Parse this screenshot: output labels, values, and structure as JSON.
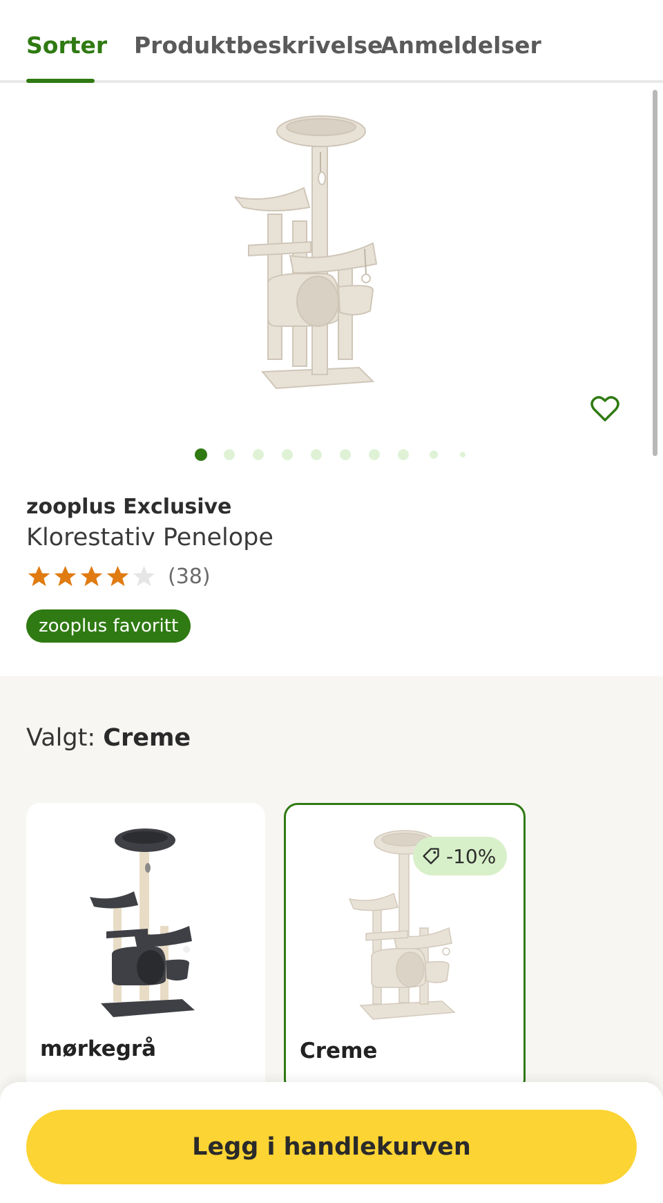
{
  "tabs": [
    {
      "label": "Sorter",
      "active": true
    },
    {
      "label": "Produktbeskrivelse",
      "active": false
    },
    {
      "label": "Anmeldelser",
      "active": false
    }
  ],
  "colors": {
    "accent": "#2f7a12",
    "cart_button": "#fcd433",
    "discount_badge": "#d8f0c9",
    "star_filled": "#e07b12",
    "star_empty": "#e6e6e6",
    "section_bg": "#f7f6f2"
  },
  "gallery": {
    "image_count": 10,
    "active_index": 0,
    "wishlist_icon": "heart-outline-icon"
  },
  "product": {
    "brand": "zooplus Exclusive",
    "name": "Klorestativ Penelope",
    "rating": 4,
    "rating_max": 5,
    "review_count": "(38)",
    "badge": "zooplus favoritt"
  },
  "variants": {
    "selected_prefix": "Valgt:",
    "selected_value": "Creme",
    "options": [
      {
        "name": "mørkegrå",
        "selected": false,
        "discount": ""
      },
      {
        "name": "Creme",
        "selected": true,
        "discount": "-10%"
      }
    ]
  },
  "cart": {
    "button_label": "Legg i handlekurven"
  }
}
